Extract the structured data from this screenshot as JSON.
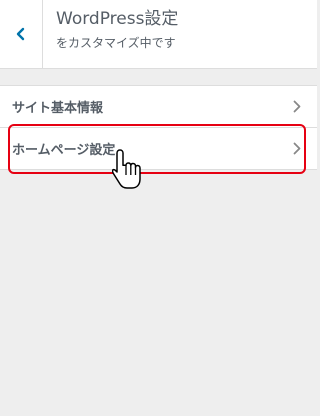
{
  "header": {
    "title": "WordPress設定",
    "subtitle": "をカスタマイズ中です",
    "back_icon": "chevron-left-icon"
  },
  "menu": {
    "items": [
      {
        "label": "サイト基本情報",
        "icon": "chevron-right-icon"
      },
      {
        "label": "ホームページ設定",
        "icon": "chevron-right-icon"
      }
    ]
  },
  "colors": {
    "accent": "#0073aa",
    "highlight": "#e60012",
    "text": "#555d66",
    "background": "#eeeeee"
  }
}
